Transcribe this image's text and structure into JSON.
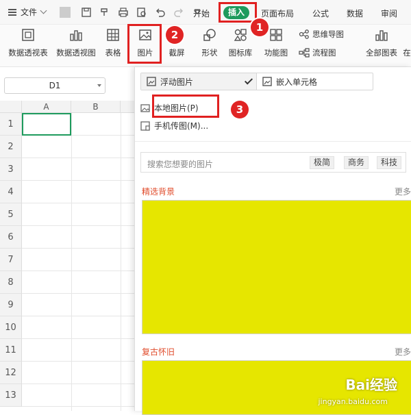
{
  "menubar": {
    "file_label": "文件",
    "tabs": [
      "开始",
      "插入",
      "页面布局",
      "公式",
      "数据",
      "审阅"
    ]
  },
  "ribbon": {
    "pivot_table": "数据透视表",
    "pivot_chart": "数据透视图",
    "table": "表格",
    "picture": "图片",
    "screenshot": "截屏",
    "shapes": "形状",
    "icon_lib": "图标库",
    "function_chart": "功能图",
    "mindmap": "思维导图",
    "flowchart": "流程图",
    "all_charts": "全部图表",
    "cut_char": "在"
  },
  "namebox": {
    "value": "D1"
  },
  "sheet": {
    "columns": [
      "A",
      "B"
    ],
    "rows": [
      "1",
      "2",
      "3",
      "4",
      "5",
      "6",
      "7",
      "8",
      "9",
      "10",
      "11",
      "12",
      "13"
    ]
  },
  "panel": {
    "float_picture": "浮动图片",
    "embed_cell": "嵌入单元格",
    "local_picture": "本地图片(P)",
    "phone_picture": "手机传图(M)...",
    "search_placeholder": "搜索您想要的图片",
    "chips": [
      "极简",
      "商务",
      "科技"
    ],
    "section1_title": "精选背景",
    "section1_more": "更多",
    "section2_title": "复古怀旧",
    "section2_more": "更多"
  },
  "badges": [
    "1",
    "2",
    "3"
  ],
  "watermark": {
    "brand": "Bai经验",
    "url": "jingyan.baidu.com"
  },
  "colors": {
    "accent_green": "#1e9b5d",
    "highlight_red": "#e02020",
    "placeholder_yellow": "#e6e600",
    "section_title": "#e04b2b"
  }
}
